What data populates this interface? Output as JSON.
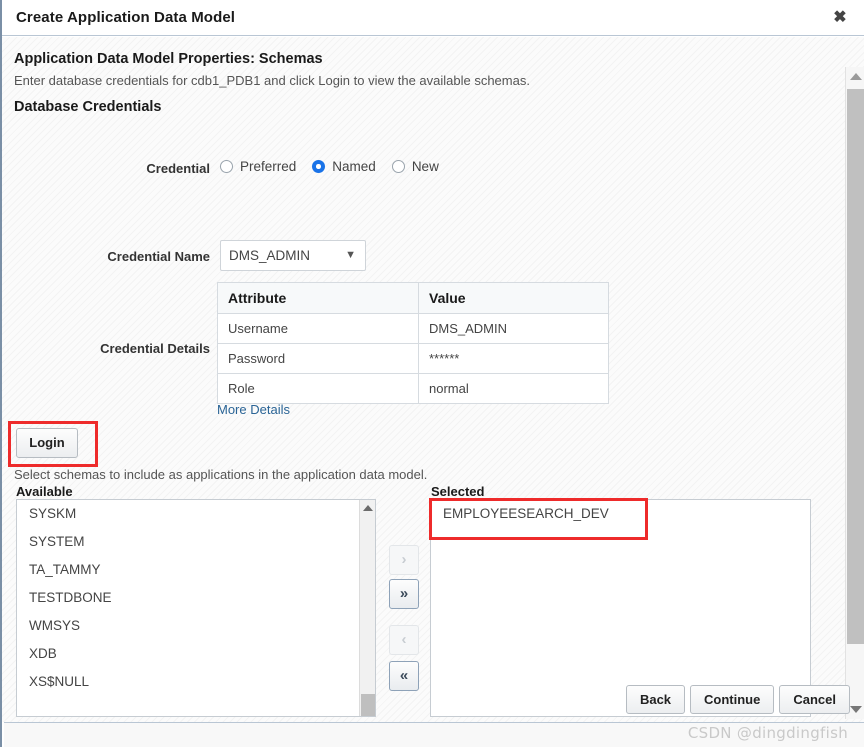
{
  "window": {
    "title": "Create Application Data Model",
    "close_icon": "close-icon"
  },
  "page": {
    "heading": "Application Data Model Properties: Schemas",
    "subtext": "Enter database credentials for cdb1_PDB1 and click Login to view the available schemas.",
    "section_title": "Database Credentials"
  },
  "credential": {
    "label": "Credential",
    "options": [
      {
        "label": "Preferred",
        "selected": false
      },
      {
        "label": "Named",
        "selected": true
      },
      {
        "label": "New",
        "selected": false
      }
    ],
    "name_label": "Credential Name",
    "name_value": "DMS_ADMIN",
    "chevron_icon": "chevron-down-icon",
    "details_label": "Credential Details",
    "table": {
      "headers": [
        "Attribute",
        "Value"
      ],
      "rows": [
        [
          "Username",
          "DMS_ADMIN"
        ],
        [
          "Password",
          "******"
        ],
        [
          "Role",
          "normal"
        ]
      ]
    },
    "more_details_link": "More Details"
  },
  "login": {
    "label": "Login",
    "highlight_color": "#ee2b2b"
  },
  "schemas": {
    "help_text": "Select schemas to include as applications in the application data model.",
    "available_label": "Available",
    "selected_label": "Selected",
    "available_items": [
      "SYSKM",
      "SYSTEM",
      "TA_TAMMY",
      "TESTDBONE",
      "WMSYS",
      "XDB",
      "XS$NULL"
    ],
    "selected_items": [
      "EMPLOYEESEARCH_DEV"
    ],
    "transfer": {
      "move_right": "›",
      "move_right_all": "»",
      "move_left": "‹",
      "move_left_all": "«"
    }
  },
  "footer": {
    "buttons": [
      "Back",
      "Continue",
      "Cancel"
    ],
    "watermark": "CSDN @dingdingfish"
  }
}
